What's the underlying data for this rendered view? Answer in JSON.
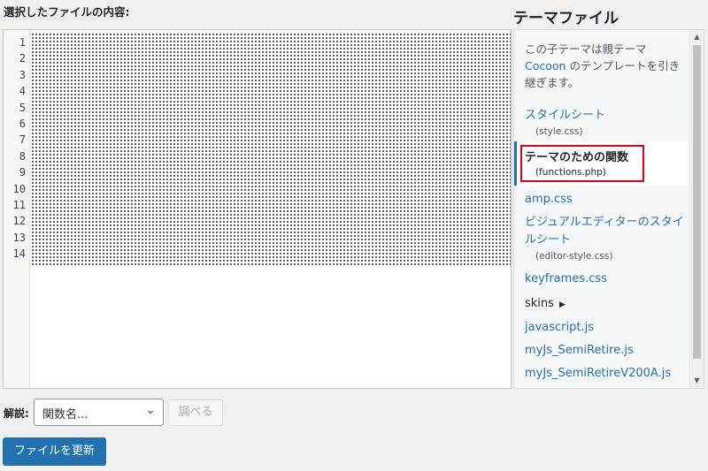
{
  "editor": {
    "heading": "選択したファイルの内容:",
    "line_numbers": [
      "1",
      "2",
      "3",
      "4",
      "5",
      "6",
      "7",
      "8",
      "9",
      "10",
      "11",
      "12",
      "13",
      "14"
    ]
  },
  "files": {
    "title": "テーマファイル",
    "desc_prefix": "この子テーマは親テーマ",
    "parent_theme": "Cocoon",
    "desc_suffix": " のテンプレートを引き継ぎます。",
    "items": [
      {
        "label": "スタイルシート",
        "sub": "(style.css)"
      },
      {
        "label": "テーマのための関数",
        "sub": "(functions.php)",
        "active": true
      },
      {
        "label": "amp.css"
      },
      {
        "label": "ビジュアルエディターのスタイルシート",
        "sub": "(editor-style.css)"
      },
      {
        "label": "keyframes.css"
      },
      {
        "label": "skins",
        "folder": true
      },
      {
        "label": "javascript.js"
      },
      {
        "label": "myJs_SemiRetire.js"
      },
      {
        "label": "myJs_SemiRetireV200A.js"
      }
    ]
  },
  "documentation": {
    "label": "解説:",
    "select_value": "関数名...",
    "lookup_button": "調べる"
  },
  "update_button": "ファイルを更新",
  "colors": {
    "accent": "#2271b1",
    "highlight": "#e60012"
  }
}
